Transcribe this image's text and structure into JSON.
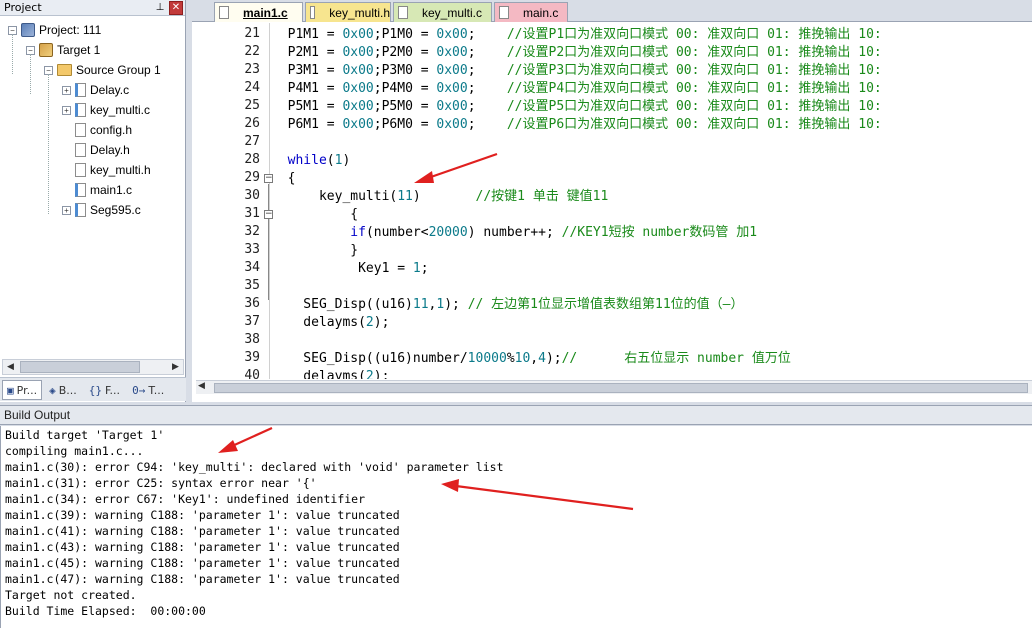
{
  "project_panel": {
    "title": "Project",
    "tree": [
      {
        "label": "Project: 111",
        "level": 0,
        "expander": "−",
        "icon": "project-icon"
      },
      {
        "label": "Target 1",
        "level": 1,
        "expander": "−",
        "icon": "target-icon"
      },
      {
        "label": "Source Group 1",
        "level": 2,
        "expander": "−",
        "icon": "folder-icon"
      },
      {
        "label": "Delay.c",
        "level": 3,
        "expander": "+",
        "icon": "c-file-icon"
      },
      {
        "label": "key_multi.c",
        "level": 3,
        "expander": "+",
        "icon": "c-file-icon"
      },
      {
        "label": "config.h",
        "level": 3,
        "expander": "",
        "icon": "h-file-icon"
      },
      {
        "label": "Delay.h",
        "level": 3,
        "expander": "",
        "icon": "h-file-icon"
      },
      {
        "label": "key_multi.h",
        "level": 3,
        "expander": "",
        "icon": "h-file-icon"
      },
      {
        "label": "main1.c",
        "level": 3,
        "expander": "",
        "icon": "c-file-icon"
      },
      {
        "label": "Seg595.c",
        "level": 3,
        "expander": "+",
        "icon": "c-file-icon"
      }
    ],
    "bottom_tabs": [
      {
        "icon": "▣",
        "label": "Pr..."
      },
      {
        "icon": "◈",
        "label": "B..."
      },
      {
        "icon": "{}",
        "label": "F..."
      },
      {
        "icon": "0→",
        "label": "T..."
      }
    ]
  },
  "editor": {
    "tabs": [
      {
        "label": "main1.c",
        "active": true,
        "color": "#fffbd6"
      },
      {
        "label": "key_multi.h",
        "active": false,
        "color": "#f7e58f"
      },
      {
        "label": "key_multi.c",
        "active": false,
        "color": "#d7e8b5"
      },
      {
        "label": "main.c",
        "active": false,
        "color": "#f4b9c3"
      }
    ],
    "lines": [
      {
        "n": "21",
        "fold": "",
        "tokens": [
          [
            "",
            "  P1M1 = "
          ],
          [
            "num",
            "0x00"
          ],
          [
            "",
            ";P1M0 = "
          ],
          [
            "num",
            "0x00"
          ],
          [
            "",
            ";    "
          ],
          [
            "cmt",
            "//设置P1口为准双向口模式 00: 准双向口 01: 推挽输出 10:"
          ]
        ]
      },
      {
        "n": "22",
        "fold": "",
        "tokens": [
          [
            "",
            "  P2M1 = "
          ],
          [
            "num",
            "0x00"
          ],
          [
            "",
            ";P2M0 = "
          ],
          [
            "num",
            "0x00"
          ],
          [
            "",
            ";    "
          ],
          [
            "cmt",
            "//设置P2口为准双向口模式 00: 准双向口 01: 推挽输出 10:"
          ]
        ]
      },
      {
        "n": "23",
        "fold": "",
        "tokens": [
          [
            "",
            "  P3M1 = "
          ],
          [
            "num",
            "0x00"
          ],
          [
            "",
            ";P3M0 = "
          ],
          [
            "num",
            "0x00"
          ],
          [
            "",
            ";    "
          ],
          [
            "cmt",
            "//设置P3口为准双向口模式 00: 准双向口 01: 推挽输出 10:"
          ]
        ]
      },
      {
        "n": "24",
        "fold": "",
        "tokens": [
          [
            "",
            "  P4M1 = "
          ],
          [
            "num",
            "0x00"
          ],
          [
            "",
            ";P4M0 = "
          ],
          [
            "num",
            "0x00"
          ],
          [
            "",
            ";    "
          ],
          [
            "cmt",
            "//设置P4口为准双向口模式 00: 准双向口 01: 推挽输出 10:"
          ]
        ]
      },
      {
        "n": "25",
        "fold": "",
        "tokens": [
          [
            "",
            "  P5M1 = "
          ],
          [
            "num",
            "0x00"
          ],
          [
            "",
            ";P5M0 = "
          ],
          [
            "num",
            "0x00"
          ],
          [
            "",
            ";    "
          ],
          [
            "cmt",
            "//设置P5口为准双向口模式 00: 准双向口 01: 推挽输出 10:"
          ]
        ]
      },
      {
        "n": "26",
        "fold": "",
        "tokens": [
          [
            "",
            "  P6M1 = "
          ],
          [
            "num",
            "0x00"
          ],
          [
            "",
            ";P6M0 = "
          ],
          [
            "num",
            "0x00"
          ],
          [
            "",
            ";    "
          ],
          [
            "cmt",
            "//设置P6口为准双向口模式 00: 准双向口 01: 推挽输出 10:"
          ]
        ]
      },
      {
        "n": "27",
        "fold": "",
        "tokens": []
      },
      {
        "n": "28",
        "fold": "",
        "tokens": [
          [
            "",
            "  "
          ],
          [
            "kw",
            "while"
          ],
          [
            "",
            "("
          ],
          [
            "num",
            "1"
          ],
          [
            "",
            ")"
          ]
        ]
      },
      {
        "n": "29",
        "fold": "−",
        "tokens": [
          [
            "",
            "  {"
          ]
        ]
      },
      {
        "n": "30",
        "fold": "",
        "tokens": [
          [
            "",
            "      key_multi("
          ],
          [
            "num",
            "11"
          ],
          [
            "",
            ")       "
          ],
          [
            "cmt",
            "//按键1 单击 键值11"
          ]
        ]
      },
      {
        "n": "31",
        "fold": "−",
        "tokens": [
          [
            "",
            "          {"
          ]
        ]
      },
      {
        "n": "32",
        "fold": "",
        "tokens": [
          [
            "",
            "          "
          ],
          [
            "kw",
            "if"
          ],
          [
            "",
            "(number<"
          ],
          [
            "num",
            "20000"
          ],
          [
            "",
            ") number++; "
          ],
          [
            "cmt",
            "//KEY1短按 number数码管 加1"
          ]
        ]
      },
      {
        "n": "33",
        "fold": "",
        "tokens": [
          [
            "",
            "          }"
          ]
        ]
      },
      {
        "n": "34",
        "fold": "",
        "tokens": [
          [
            "",
            "           Key1 = "
          ],
          [
            "num",
            "1"
          ],
          [
            "",
            ";"
          ]
        ]
      },
      {
        "n": "35",
        "fold": "",
        "tokens": []
      },
      {
        "n": "36",
        "fold": "",
        "tokens": [
          [
            "",
            "    SEG_Disp((u16)"
          ],
          [
            "num",
            "11"
          ],
          [
            "",
            ","
          ],
          [
            "num",
            "1"
          ],
          [
            "",
            "); "
          ],
          [
            "cmt",
            "// 左边第1位显示增值表数组第11位的值（—）"
          ]
        ]
      },
      {
        "n": "37",
        "fold": "",
        "tokens": [
          [
            "",
            "    delayms("
          ],
          [
            "num",
            "2"
          ],
          [
            "",
            ");"
          ]
        ]
      },
      {
        "n": "38",
        "fold": "",
        "tokens": []
      },
      {
        "n": "39",
        "fold": "",
        "tokens": [
          [
            "",
            "    SEG_Disp((u16)number/"
          ],
          [
            "num",
            "10000"
          ],
          [
            "",
            "%"
          ],
          [
            "num",
            "10"
          ],
          [
            "",
            ","
          ],
          [
            "num",
            "4"
          ],
          [
            "",
            ");"
          ],
          [
            "cmt",
            "//      右五位显示 number 值万位"
          ]
        ]
      },
      {
        "n": "40",
        "fold": "",
        "tokens": [
          [
            "",
            "    delayms("
          ],
          [
            "num",
            "2"
          ],
          [
            "",
            ");"
          ]
        ]
      }
    ]
  },
  "build_output": {
    "title": "Build Output",
    "lines": [
      "Build target 'Target 1'",
      "compiling main1.c...",
      "main1.c(30): error C94: 'key_multi': declared with 'void' parameter list",
      "main1.c(31): error C25: syntax error near '{'",
      "main1.c(34): error C67: 'Key1': undefined identifier",
      "main1.c(39): warning C188: 'parameter 1': value truncated",
      "main1.c(41): warning C188: 'parameter 1': value truncated",
      "main1.c(43): warning C188: 'parameter 1': value truncated",
      "main1.c(45): warning C188: 'parameter 1': value truncated",
      "main1.c(47): warning C188: 'parameter 1': value truncated",
      "Target not created.",
      "Build Time Elapsed:  00:00:00"
    ]
  },
  "colors": {
    "annotation_arrow": "#e0201f",
    "keyword": "#0000c8",
    "number": "#0b7a8a",
    "comment": "#1a8a1a"
  }
}
